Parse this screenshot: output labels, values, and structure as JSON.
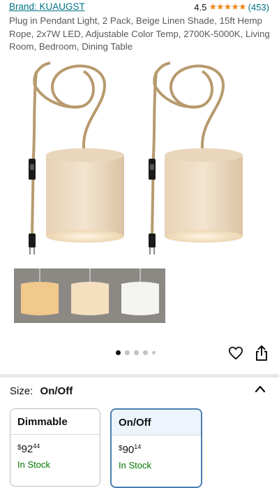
{
  "product": {
    "brand": "Brand: KUAUGST",
    "rating_value": "4.5",
    "rating_stars": "★★★★★",
    "rating_count": "(453)",
    "title": "Plug in Pendant Light, 2 Pack, Beige Linen Shade, 15ft Hemp Rope, 2x7W LED, Adjustable Color Temp, 2700K-5000K, Living Room, Bedroom, Dining Table"
  },
  "gallery": {
    "image_count": 5,
    "active_index": 0
  },
  "actions": {
    "heart_icon": "heart-icon",
    "share_icon": "share-icon"
  },
  "size": {
    "label": "Size:",
    "value": "On/Off"
  },
  "options": [
    {
      "name": "Dimmable",
      "currency": "$",
      "price_whole": "92",
      "price_fraction": "44",
      "stock": "In Stock"
    },
    {
      "name": "On/Off",
      "currency": "$",
      "price_whole": "90",
      "price_fraction": "14",
      "stock": "In Stock"
    }
  ],
  "colors": {
    "link": "#007185",
    "star": "#f0891a",
    "in_stock": "#007600",
    "selected_border": "#4a7eb3"
  }
}
